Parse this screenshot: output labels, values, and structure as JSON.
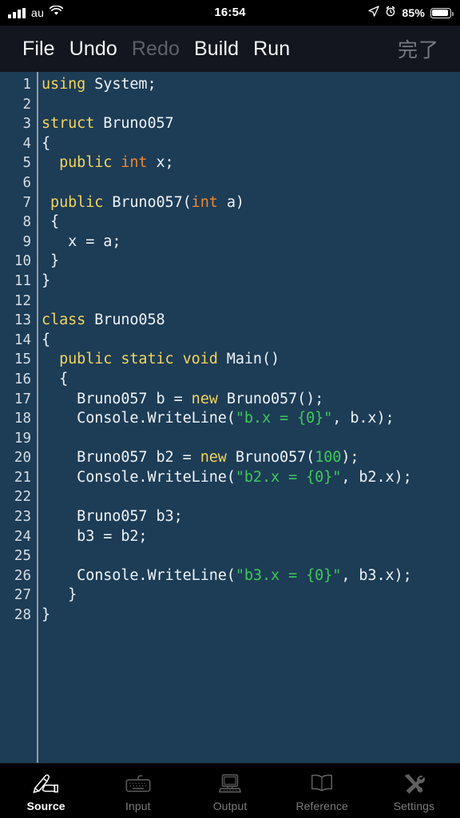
{
  "status_bar": {
    "carrier": "au",
    "time": "16:54",
    "battery_percent": "85%",
    "signal_icon": "signal-bars-icon",
    "wifi_icon": "wifi-icon",
    "location_icon": "location-arrow-icon",
    "alarm_icon": "alarm-clock-icon",
    "battery_icon": "battery-icon"
  },
  "toolbar": {
    "file_label": "File",
    "undo_label": "Undo",
    "redo_label": "Redo",
    "build_label": "Build",
    "run_label": "Run",
    "done_label": "完了"
  },
  "editor": {
    "language": "csharp",
    "colors": {
      "background": "#1d3c56",
      "gutter_text": "#d6dde3",
      "gutter_rule": "#8d9ba6",
      "plain": "#eef3f7",
      "keyword": "#f2d55c",
      "type": "#f0872e",
      "string": "#3ec95a",
      "number": "#3ec95a"
    },
    "lines": [
      {
        "n": "1",
        "tokens": [
          {
            "t": "using",
            "c": "kw"
          },
          {
            "t": " System;",
            "c": "pln"
          }
        ]
      },
      {
        "n": "2",
        "tokens": []
      },
      {
        "n": "3",
        "tokens": [
          {
            "t": "struct",
            "c": "kw"
          },
          {
            "t": " Bruno057",
            "c": "pln"
          }
        ]
      },
      {
        "n": "4",
        "tokens": [
          {
            "t": "{",
            "c": "pln"
          }
        ]
      },
      {
        "n": "5",
        "tokens": [
          {
            "t": "  ",
            "c": "pln"
          },
          {
            "t": "public",
            "c": "kw"
          },
          {
            "t": " ",
            "c": "pln"
          },
          {
            "t": "int",
            "c": "typ"
          },
          {
            "t": " x;",
            "c": "pln"
          }
        ]
      },
      {
        "n": "6",
        "tokens": []
      },
      {
        "n": "7",
        "tokens": [
          {
            "t": " ",
            "c": "pln"
          },
          {
            "t": "public",
            "c": "kw"
          },
          {
            "t": " Bruno057(",
            "c": "pln"
          },
          {
            "t": "int",
            "c": "typ"
          },
          {
            "t": " a)",
            "c": "pln"
          }
        ]
      },
      {
        "n": "8",
        "tokens": [
          {
            "t": " {",
            "c": "pln"
          }
        ]
      },
      {
        "n": "9",
        "tokens": [
          {
            "t": "   x = a;",
            "c": "pln"
          }
        ]
      },
      {
        "n": "10",
        "tokens": [
          {
            "t": " }",
            "c": "pln"
          }
        ]
      },
      {
        "n": "11",
        "tokens": [
          {
            "t": "}",
            "c": "pln"
          }
        ]
      },
      {
        "n": "12",
        "tokens": []
      },
      {
        "n": "13",
        "tokens": [
          {
            "t": "class",
            "c": "kw"
          },
          {
            "t": " Bruno058",
            "c": "pln"
          }
        ]
      },
      {
        "n": "14",
        "tokens": [
          {
            "t": "{",
            "c": "pln"
          }
        ]
      },
      {
        "n": "15",
        "tokens": [
          {
            "t": "  ",
            "c": "pln"
          },
          {
            "t": "public static void",
            "c": "kw"
          },
          {
            "t": " Main()",
            "c": "pln"
          }
        ]
      },
      {
        "n": "16",
        "tokens": [
          {
            "t": "  {",
            "c": "pln"
          }
        ]
      },
      {
        "n": "17",
        "tokens": [
          {
            "t": "    Bruno057 b = ",
            "c": "pln"
          },
          {
            "t": "new",
            "c": "kw"
          },
          {
            "t": " Bruno057();",
            "c": "pln"
          }
        ]
      },
      {
        "n": "18",
        "tokens": [
          {
            "t": "    Console.WriteLine(",
            "c": "pln"
          },
          {
            "t": "\"b.x = {0}\"",
            "c": "str"
          },
          {
            "t": ", b.x);",
            "c": "pln"
          }
        ]
      },
      {
        "n": "19",
        "tokens": []
      },
      {
        "n": "20",
        "tokens": [
          {
            "t": "    Bruno057 b2 = ",
            "c": "pln"
          },
          {
            "t": "new",
            "c": "kw"
          },
          {
            "t": " Bruno057(",
            "c": "pln"
          },
          {
            "t": "100",
            "c": "num"
          },
          {
            "t": ");",
            "c": "pln"
          }
        ]
      },
      {
        "n": "21",
        "tokens": [
          {
            "t": "    Console.WriteLine(",
            "c": "pln"
          },
          {
            "t": "\"b2.x = {0}\"",
            "c": "str"
          },
          {
            "t": ", b2.x);",
            "c": "pln"
          }
        ]
      },
      {
        "n": "22",
        "tokens": []
      },
      {
        "n": "23",
        "tokens": [
          {
            "t": "    Bruno057 b3;",
            "c": "pln"
          }
        ]
      },
      {
        "n": "24",
        "tokens": [
          {
            "t": "    b3 = b2;",
            "c": "pln"
          }
        ]
      },
      {
        "n": "25",
        "tokens": []
      },
      {
        "n": "26",
        "tokens": [
          {
            "t": "    Console.WriteLine(",
            "c": "pln"
          },
          {
            "t": "\"b3.x = {0}\"",
            "c": "str"
          },
          {
            "t": ", b3.x);",
            "c": "pln"
          }
        ]
      },
      {
        "n": "27",
        "tokens": [
          {
            "t": "   }",
            "c": "pln"
          }
        ]
      },
      {
        "n": "28",
        "tokens": [
          {
            "t": "}",
            "c": "pln"
          }
        ]
      }
    ]
  },
  "tabbar": {
    "items": [
      {
        "label": "Source",
        "icon": "hand-writing-pen-icon",
        "active": true
      },
      {
        "label": "Input",
        "icon": "keyboard-icon",
        "active": false
      },
      {
        "label": "Output",
        "icon": "computer-monitor-icon",
        "active": false
      },
      {
        "label": "Reference",
        "icon": "open-book-icon",
        "active": false
      },
      {
        "label": "Settings",
        "icon": "hammer-wrench-icon",
        "active": false
      }
    ]
  }
}
